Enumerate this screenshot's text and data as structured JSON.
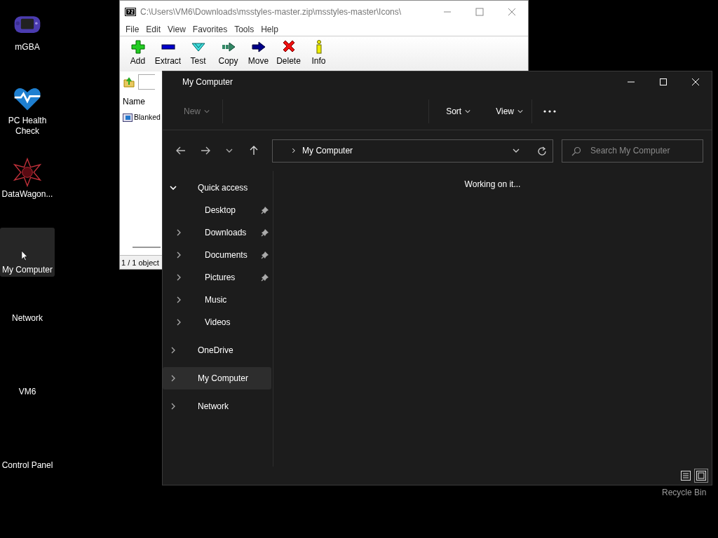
{
  "desktop_icons": [
    {
      "label": "mGBA",
      "kind": "console",
      "selected": false
    },
    {
      "label": "PC Health Check",
      "kind": "heart",
      "selected": false
    },
    {
      "label": "DataWagon...",
      "kind": "star",
      "selected": false
    },
    {
      "label": "My Computer",
      "kind": "none",
      "selected": true
    },
    {
      "label": "Network",
      "kind": "none",
      "selected": false
    },
    {
      "label": "VM6",
      "kind": "none",
      "selected": false
    },
    {
      "label": "Control Panel",
      "kind": "none",
      "selected": false
    }
  ],
  "recycle_bin": {
    "label": "Recycle Bin"
  },
  "archive_window": {
    "title": "C:\\Users\\VM6\\Downloads\\msstyles-master.zip\\msstyles-master\\Icons\\",
    "menu": [
      "File",
      "Edit",
      "View",
      "Favorites",
      "Tools",
      "Help"
    ],
    "toolbar": [
      {
        "label": "Add",
        "kind": "add"
      },
      {
        "label": "Extract",
        "kind": "extract"
      },
      {
        "label": "Test",
        "kind": "test"
      },
      {
        "label": "Copy",
        "kind": "copy"
      },
      {
        "label": "Move",
        "kind": "move"
      },
      {
        "label": "Delete",
        "kind": "delete"
      },
      {
        "label": "Info",
        "kind": "info"
      }
    ],
    "column": "Name",
    "file": "Blanked",
    "status": "1 / 1 object"
  },
  "explorer": {
    "title": "My Computer",
    "commands": [
      {
        "label": "New",
        "disabled": true
      },
      {
        "label": "Sort",
        "disabled": false
      },
      {
        "label": "View",
        "disabled": false
      }
    ],
    "address": "My Computer",
    "search": {
      "placeholder": "Search My Computer"
    },
    "tree": [
      {
        "label": "Quick access",
        "expandable": true,
        "expanded": true,
        "pinned": false,
        "selected": false,
        "children": [
          {
            "label": "Desktop",
            "expandable": false,
            "expanded": false,
            "pinned": true,
            "selected": false
          },
          {
            "label": "Downloads",
            "expandable": true,
            "expanded": false,
            "pinned": true,
            "selected": false
          },
          {
            "label": "Documents",
            "expandable": true,
            "expanded": false,
            "pinned": true,
            "selected": false
          },
          {
            "label": "Pictures",
            "expandable": true,
            "expanded": false,
            "pinned": true,
            "selected": false
          },
          {
            "label": "Music",
            "expandable": true,
            "expanded": false,
            "pinned": false,
            "selected": false
          },
          {
            "label": "Videos",
            "expandable": true,
            "expanded": false,
            "pinned": false,
            "selected": false
          }
        ]
      },
      {
        "label": "OneDrive",
        "expandable": true,
        "expanded": false,
        "pinned": false,
        "selected": false
      },
      {
        "label": "My Computer",
        "expandable": true,
        "expanded": false,
        "pinned": false,
        "selected": true
      },
      {
        "label": "Network",
        "expandable": true,
        "expanded": false,
        "pinned": false,
        "selected": false
      }
    ],
    "message": "Working on it...",
    "view_modes": [
      {
        "kind": "details",
        "selected": false
      },
      {
        "kind": "tiles",
        "selected": true
      }
    ]
  }
}
